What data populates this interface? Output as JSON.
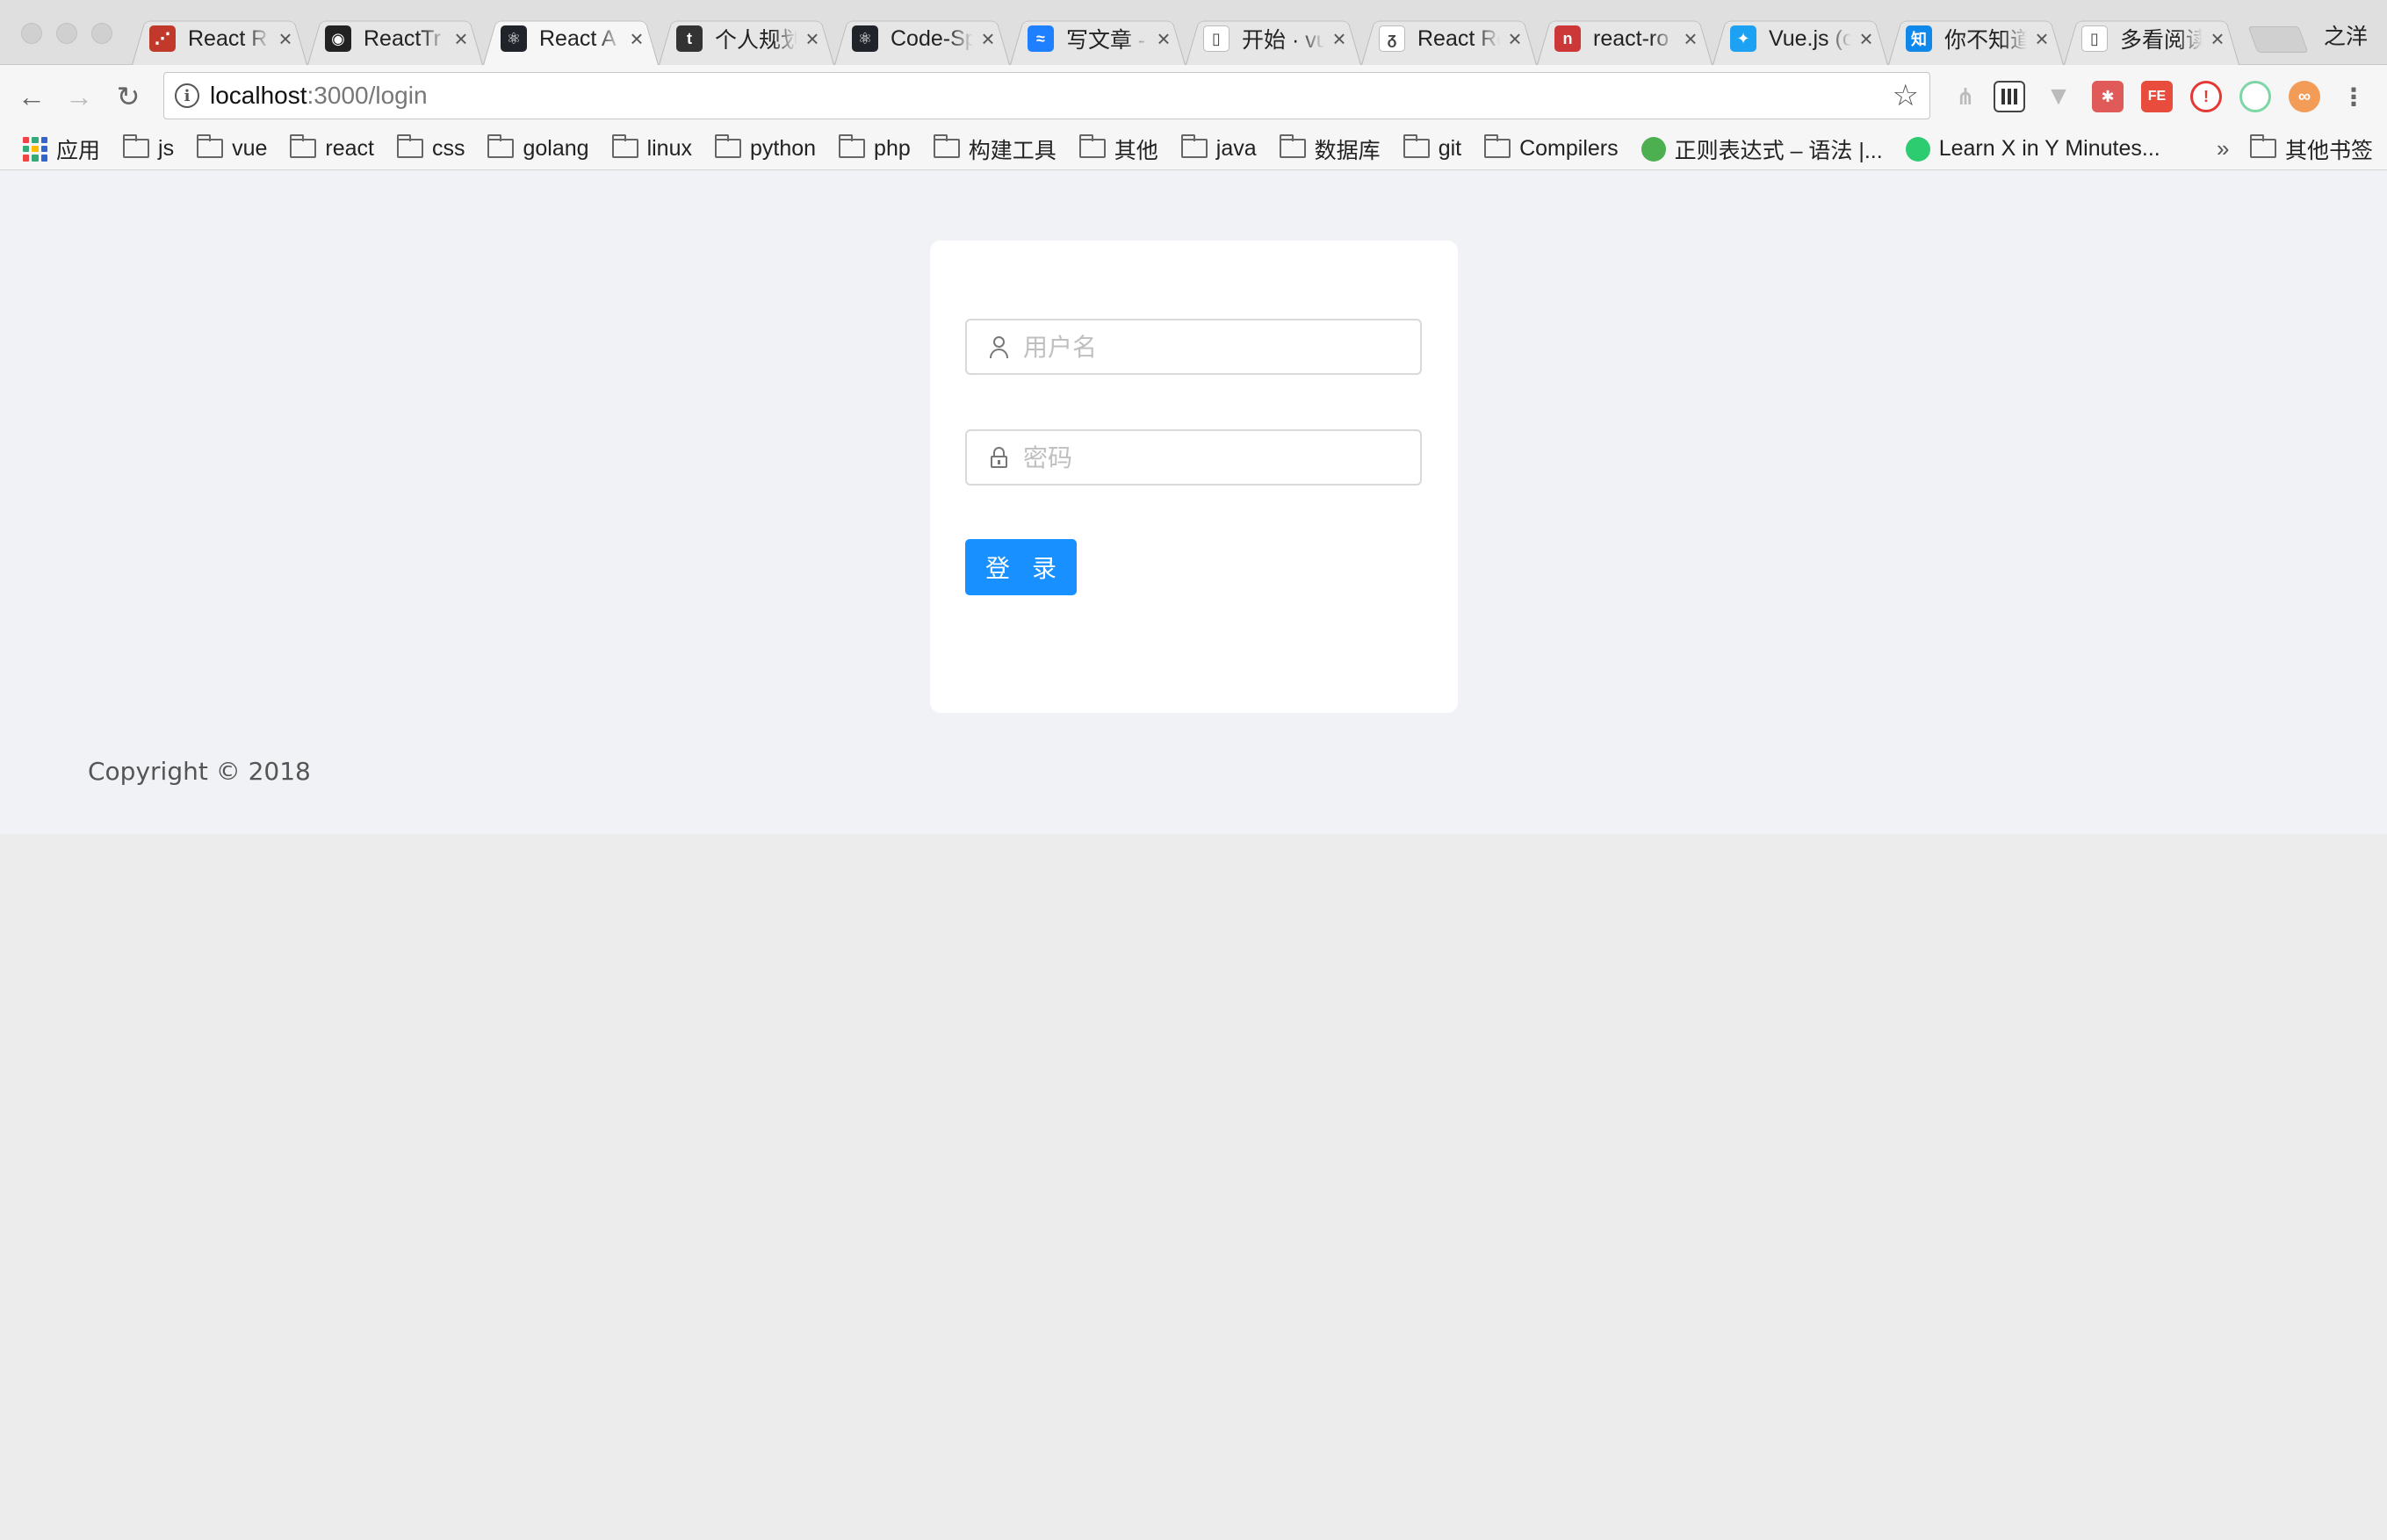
{
  "browser": {
    "tabs": [
      {
        "label": "React R",
        "icon": "react-redux-icon",
        "color": "#c0392b",
        "glyph": "⋰"
      },
      {
        "label": "ReactTr",
        "icon": "github-icon",
        "color": "#222222",
        "glyph": "◉"
      },
      {
        "label": "React A",
        "icon": "react-icon",
        "color": "#20232a",
        "glyph": "⚛",
        "active": true
      },
      {
        "label": "个人规划",
        "icon": "t-icon",
        "color": "#333333",
        "glyph": "t"
      },
      {
        "label": "Code-Sp",
        "icon": "react-icon",
        "color": "#20232a",
        "glyph": "⚛"
      },
      {
        "label": "写文章 -",
        "icon": "juejin-icon",
        "color": "#1e80ff",
        "glyph": "≈"
      },
      {
        "label": "开始 · vu",
        "icon": "document-icon",
        "color": "#ffffff",
        "glyph": "▯"
      },
      {
        "label": "React Ro",
        "icon": "feather-icon",
        "color": "#ffffff",
        "glyph": "ᵹ"
      },
      {
        "label": "react-ro",
        "icon": "npm-icon",
        "color": "#cb3837",
        "glyph": "n"
      },
      {
        "label": "Vue.js (c",
        "icon": "twitter-icon",
        "color": "#1da1f2",
        "glyph": "✦"
      },
      {
        "label": "你不知道",
        "icon": "zhihu-icon",
        "color": "#0f88eb",
        "glyph": "知"
      },
      {
        "label": "多看阅读",
        "icon": "document-icon",
        "color": "#ffffff",
        "glyph": "▯"
      }
    ],
    "close_glyph": "×",
    "profile_name": "之洋",
    "nav": {
      "back": "←",
      "forward": "→",
      "reload": "↻"
    },
    "address": {
      "host": "localhost",
      "path": ":3000/login"
    },
    "star_glyph": "☆",
    "bookmarks": [
      {
        "label": "应用",
        "type": "apps"
      },
      {
        "label": "js",
        "type": "folder"
      },
      {
        "label": "vue",
        "type": "folder"
      },
      {
        "label": "react",
        "type": "folder"
      },
      {
        "label": "css",
        "type": "folder"
      },
      {
        "label": "golang",
        "type": "folder"
      },
      {
        "label": "linux",
        "type": "folder"
      },
      {
        "label": "python",
        "type": "folder"
      },
      {
        "label": "php",
        "type": "folder"
      },
      {
        "label": "构建工具",
        "type": "folder"
      },
      {
        "label": "其他",
        "type": "folder"
      },
      {
        "label": "java",
        "type": "folder"
      },
      {
        "label": "数据库",
        "type": "folder"
      },
      {
        "label": "git",
        "type": "folder"
      },
      {
        "label": "Compilers",
        "type": "folder"
      },
      {
        "label": "正则表达式 – 语法 |...",
        "type": "site",
        "icon": "regex-icon",
        "color": "#4caf50"
      },
      {
        "label": "Learn X in Y Minutes...",
        "type": "site",
        "icon": "learnx-icon",
        "color": "#2ecc71"
      }
    ],
    "bookmarks_more": "»",
    "other_bookmarks": "其他书签"
  },
  "login": {
    "username_placeholder": "用户名",
    "password_placeholder": "密码",
    "submit_label": "登 录"
  },
  "footer": {
    "copyright": "Copyright © 2018"
  },
  "colors": {
    "primary": "#1890ff",
    "page_bg": "#f0f2f5"
  }
}
